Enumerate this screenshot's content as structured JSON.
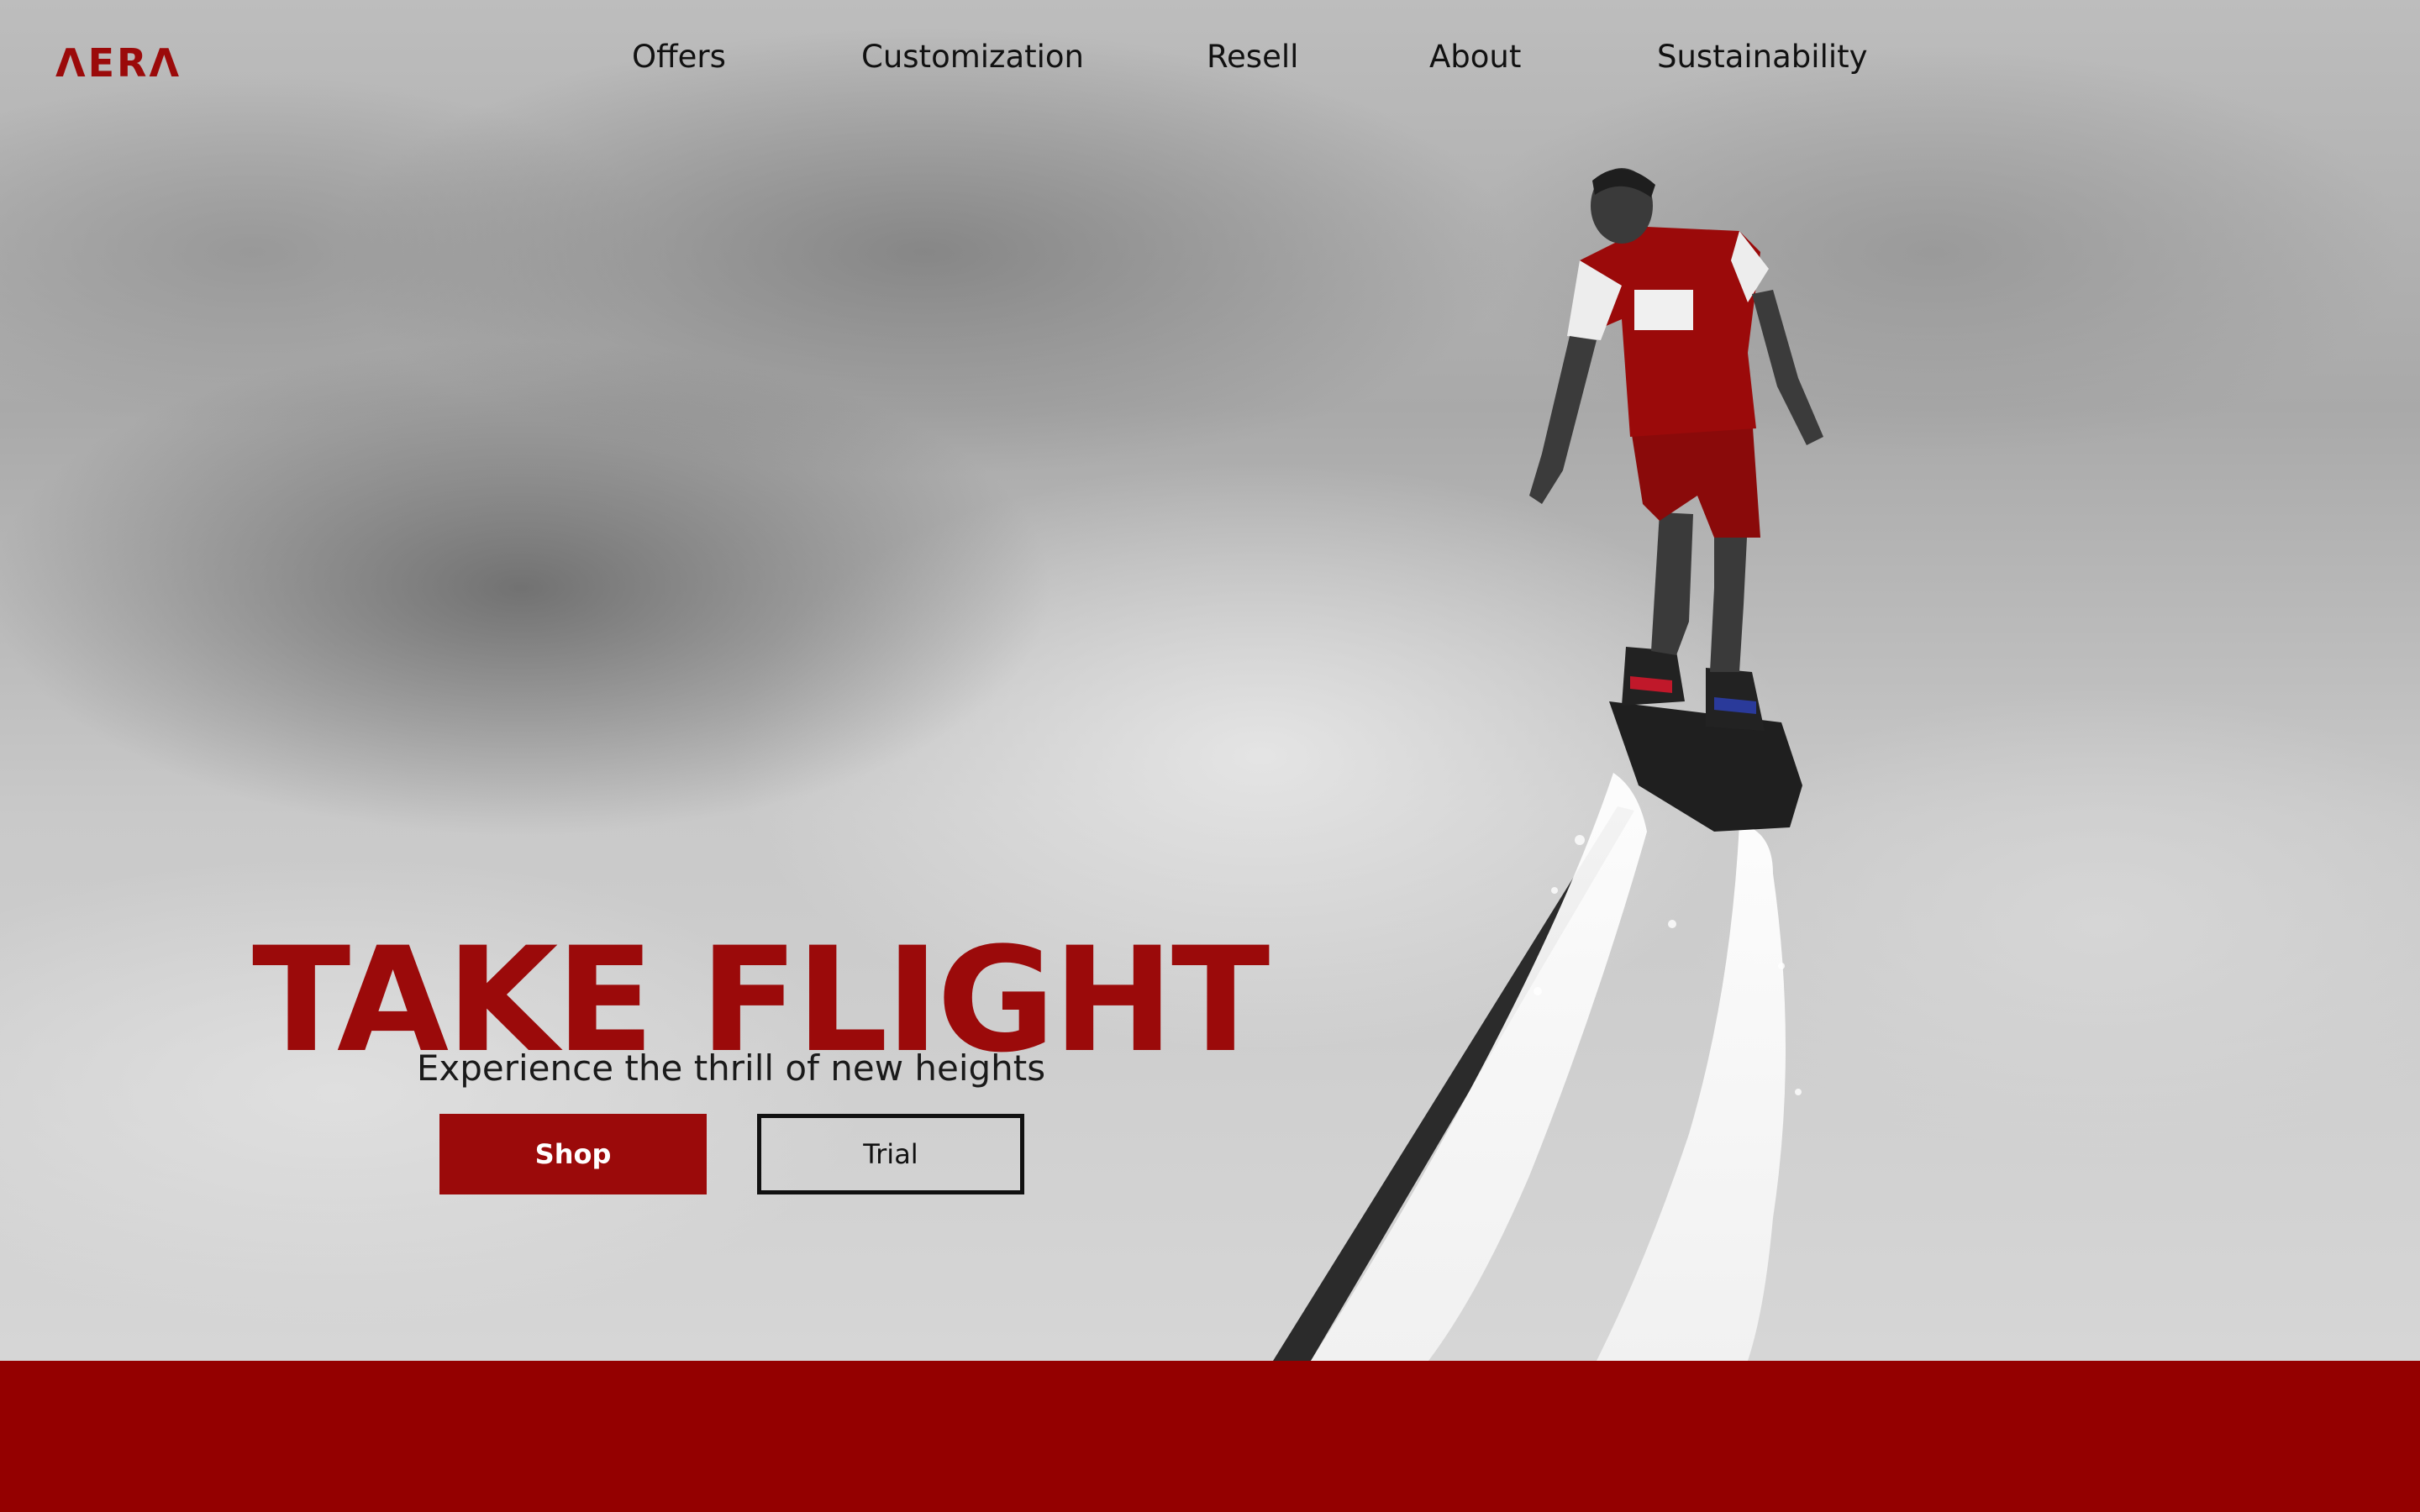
{
  "brand": {
    "logo_text": "ΛERΛ",
    "accent_color": "#9b0a0a",
    "band_color": "#940000"
  },
  "nav": {
    "items": [
      {
        "label": "Offers"
      },
      {
        "label": "Customization"
      },
      {
        "label": "Resell"
      },
      {
        "label": "About"
      },
      {
        "label": "Sustainability"
      }
    ]
  },
  "hero": {
    "headline": "TAKE FLIGHT",
    "subheadline": "Experience the thrill of new heights",
    "primary_button": "Shop",
    "secondary_button": "Trial",
    "image_description_icon": "flyboard-rider-image"
  }
}
